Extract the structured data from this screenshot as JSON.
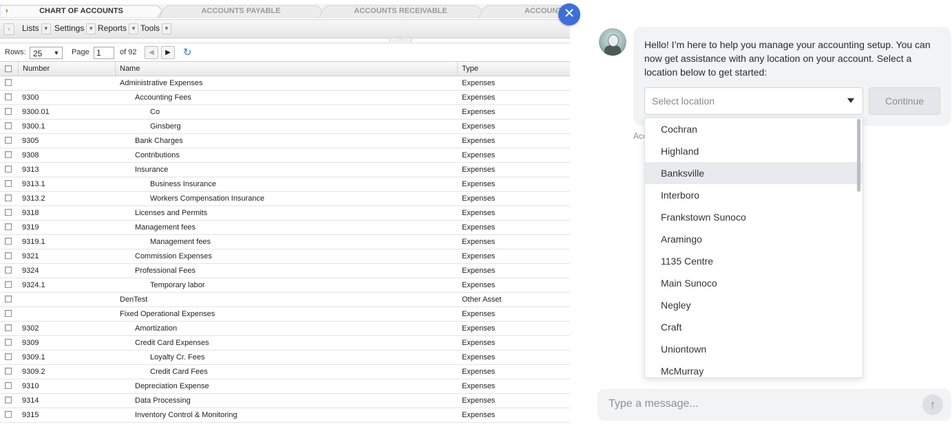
{
  "tabs": [
    {
      "label": "CHART OF ACCOUNTS",
      "active": true
    },
    {
      "label": "ACCOUNTS PAYABLE",
      "active": false
    },
    {
      "label": "ACCOUNTS RECEIVABLE",
      "active": false
    },
    {
      "label": "ACCOUNT",
      "active": false
    }
  ],
  "toolbar": {
    "lists_label": "Lists",
    "settings_label": "Settings",
    "reports_label": "Reports",
    "tools_label": "Tools"
  },
  "pager": {
    "rows_label": "Rows:",
    "rows_value": "25",
    "page_label": "Page",
    "page_value": "1",
    "of_label": "of 92"
  },
  "grid": {
    "columns": [
      "Number",
      "Name",
      "Type"
    ],
    "rows": [
      {
        "number": "",
        "name": "Administrative Expenses",
        "level": 0,
        "type": "Expenses"
      },
      {
        "number": "9300",
        "name": "Accounting Fees",
        "level": 1,
        "type": "Expenses"
      },
      {
        "number": "9300.01",
        "name": "Co",
        "level": 2,
        "type": "Expenses"
      },
      {
        "number": "9300.1",
        "name": "Ginsberg",
        "level": 2,
        "type": "Expenses"
      },
      {
        "number": "9305",
        "name": "Bank Charges",
        "level": 1,
        "type": "Expenses"
      },
      {
        "number": "9308",
        "name": "Contributions",
        "level": 1,
        "type": "Expenses"
      },
      {
        "number": "9313",
        "name": "Insurance",
        "level": 1,
        "type": "Expenses"
      },
      {
        "number": "9313.1",
        "name": "Business Insurance",
        "level": 2,
        "type": "Expenses"
      },
      {
        "number": "9313.2",
        "name": "Workers Compensation Insurance",
        "level": 2,
        "type": "Expenses"
      },
      {
        "number": "9318",
        "name": "Licenses and Permits",
        "level": 1,
        "type": "Expenses"
      },
      {
        "number": "9319",
        "name": "Management fees",
        "level": 1,
        "type": "Expenses"
      },
      {
        "number": "9319.1",
        "name": "Management fees",
        "level": 2,
        "type": "Expenses"
      },
      {
        "number": "9321",
        "name": "Commission Expenses",
        "level": 1,
        "type": "Expenses"
      },
      {
        "number": "9324",
        "name": "Professional Fees",
        "level": 1,
        "type": "Expenses"
      },
      {
        "number": "9324.1",
        "name": "Temporary labor",
        "level": 2,
        "type": "Expenses"
      },
      {
        "number": "",
        "name": "DenTest",
        "level": 0,
        "type": "Other Asset"
      },
      {
        "number": "",
        "name": "Fixed Operational Expenses",
        "level": 0,
        "type": "Expenses"
      },
      {
        "number": "9302",
        "name": "Amortization",
        "level": 1,
        "type": "Expenses"
      },
      {
        "number": "9309",
        "name": "Credit Card Expenses",
        "level": 1,
        "type": "Expenses"
      },
      {
        "number": "9309.1",
        "name": "Loyalty Cr. Fees",
        "level": 2,
        "type": "Expenses"
      },
      {
        "number": "9309.2",
        "name": "Credit Card Fees",
        "level": 2,
        "type": "Expenses"
      },
      {
        "number": "9310",
        "name": "Depreciation Expense",
        "level": 1,
        "type": "Expenses"
      },
      {
        "number": "9314",
        "name": "Data Processing",
        "level": 1,
        "type": "Expenses"
      },
      {
        "number": "9315",
        "name": "Inventory Control & Monitoring",
        "level": 1,
        "type": "Expenses"
      }
    ]
  },
  "chat": {
    "greeting": "Hello! I’m here to help you manage your accounting setup. You can now get assistance with any location on your account. Select a location below to get started:",
    "select_placeholder": "Select location",
    "continue_label": "Continue",
    "behind_text": "Acc",
    "input_placeholder": "Type a message...",
    "locations": [
      "Cochran",
      "Highland",
      "Banksville",
      "Interboro",
      "Frankstown Sunoco",
      "Aramingo",
      "1135 Centre",
      "Main Sunoco",
      "Negley",
      "Craft",
      "Uniontown",
      "McMurray"
    ],
    "highlighted_location": "Banksville"
  },
  "colors": {
    "accent": "#3d6fd8",
    "tab_active": "#333333",
    "tab_inactive": "#9a9a9a"
  },
  "icons": {
    "close": "close-icon",
    "refresh": "refresh-icon",
    "send": "send-arrow-icon",
    "dropdown": "caret-down-icon"
  }
}
